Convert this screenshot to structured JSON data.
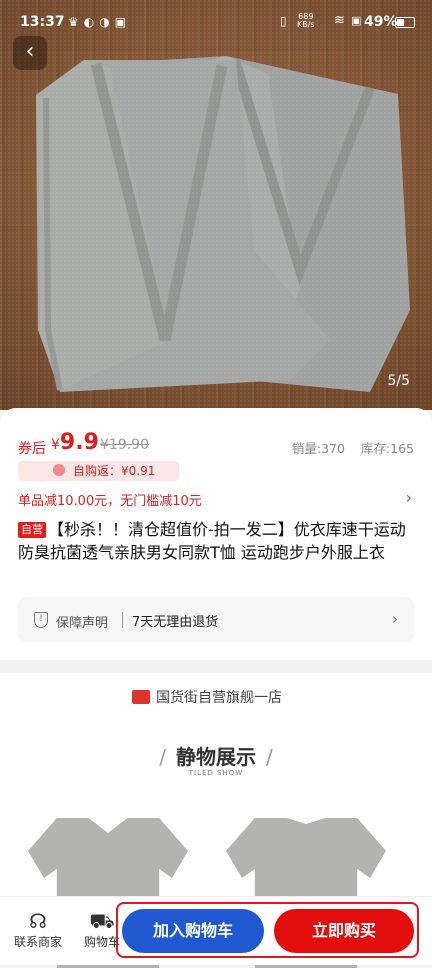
{
  "status_bar": {
    "time": "13:37",
    "net_speed_value": "689",
    "net_speed_unit": "KB/s",
    "battery": "49%",
    "icons": [
      "crown-icon",
      "app-icon",
      "app-icon",
      "app-icon",
      "vibrate-icon",
      "wifi-icon",
      "sim-icon",
      "battery-icon"
    ]
  },
  "hero": {
    "image_counter": "5/5"
  },
  "price": {
    "prefix": "券后",
    "currency": "¥",
    "value": "9.9",
    "original": "¥19.90",
    "sales": "销量:370",
    "stock": "库存:165",
    "rebate": "自购返：¥0.91",
    "promo": "单品减10.00元，无门槛减10元"
  },
  "product": {
    "tag": "自营",
    "title": "【秒杀！！清仓超值价-拍一发二】优衣库速干运动防臭抗菌透气亲肤男女同款T恤 运动跑步户外服上衣"
  },
  "guarantee": {
    "label": "保障声明",
    "value": "7天无理由退货"
  },
  "shop": {
    "name": "国货街自营旗舰一店"
  },
  "details": {
    "title": "静物展示",
    "subtitle": "TILED SHOW"
  },
  "bottom_bar": {
    "contact": "联系商家",
    "cart": "购物车",
    "add_to_cart": "加入购物车",
    "buy_now": "立即购买"
  },
  "colors": {
    "price_red": "#e01e1e",
    "cart_blue": "#1f58cf",
    "buy_red": "#e20d0d"
  }
}
